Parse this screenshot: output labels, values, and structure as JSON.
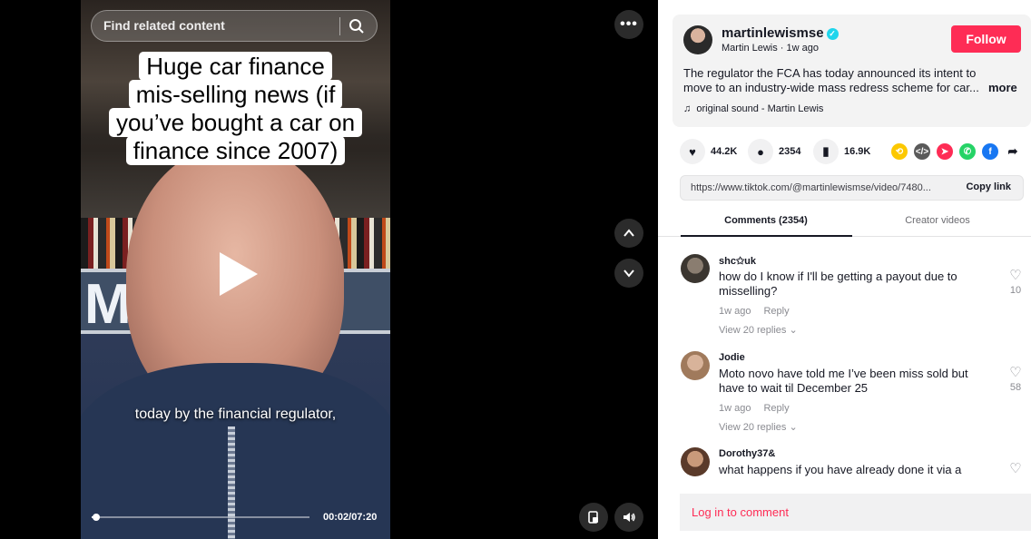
{
  "video": {
    "search_placeholder": "Find related content",
    "headline_lines": [
      "Huge car finance",
      "mis-selling news (if",
      "you’ve bought a car on",
      "finance since 2007)"
    ],
    "caption": "today by the financial regulator,",
    "time": "00:02/07:20",
    "progress_fraction": 0.005,
    "sign_text": "MAR   IS"
  },
  "post": {
    "username": "martinlewismse",
    "display_name": "Martin Lewis",
    "age": "1w ago",
    "follow_label": "Follow",
    "description": "The regulator the FCA has today announced its intent to move to an industry-wide mass redress scheme for car...",
    "more_label": "more",
    "sound": "original sound - Martin Lewis"
  },
  "stats": {
    "likes": "44.2K",
    "comments": "2354",
    "saves": "16.9K"
  },
  "share": {
    "url": "https://www.tiktok.com/@martinlewismse/video/7480...",
    "copy_label": "Copy link"
  },
  "tabs": {
    "comments": "Comments (2354)",
    "creator": "Creator videos"
  },
  "comments": [
    {
      "user": "shc✩uk",
      "text": "how do I know if I'll be getting a payout due to misselling?",
      "age": "1w ago",
      "reply_label": "Reply",
      "replies": "View 20 replies",
      "likes": "10"
    },
    {
      "user": "Jodie",
      "text": "Moto novo have told me I’ve been miss sold but have to wait til December 25",
      "age": "1w ago",
      "reply_label": "Reply",
      "replies": "View 20 replies",
      "likes": "58"
    },
    {
      "user": "Dorothy37&",
      "text": "what happens if you have already done it via a",
      "age": "",
      "reply_label": "",
      "replies": "",
      "likes": ""
    }
  ],
  "login_label": "Log in to comment",
  "colors": {
    "accent": "#fe2c55",
    "verified": "#20d5ec"
  }
}
